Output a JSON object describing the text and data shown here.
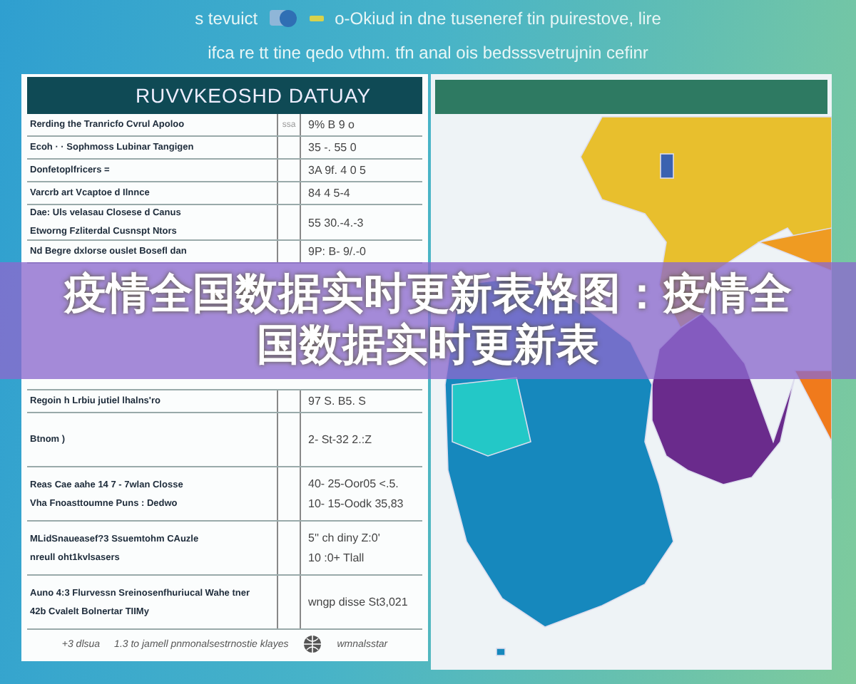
{
  "header": {
    "line_1": "s tevuict",
    "line_1_rest": "o-Okiud in dne tuseneref tin puirestove, lire",
    "line_2": "ifca re tt tine qedo vthm. tfn anal ois bedsssvetrujnin cefinr"
  },
  "table": {
    "title": "RUVVKEOSHD DATUAY",
    "rows": [
      {
        "text": [
          "Rerding the Tranricfo Cvrul Apoloo"
        ],
        "column_2": "ssa",
        "value": [
          "9% B 9 o"
        ]
      },
      {
        "text": [
          "Ecoh · · Sophmoss Lubinar Tangigen"
        ],
        "value": [
          "35 -. 55 0"
        ]
      },
      {
        "text": [
          "Donfetoplfricers ="
        ],
        "value": [
          "3A 9f. 4 0 5"
        ]
      },
      {
        "text": [
          "Varcrb art Vcaptoe d Ilnnce"
        ],
        "value": [
          "84 4 5-4"
        ]
      },
      {
        "text": [
          "Dae: Uls velasau Closese d Canus",
          "Etworng Fzliterdal Cusnspt Ntors"
        ],
        "value": [
          "55 30.-4.-3"
        ]
      },
      {
        "text": [
          "Nd Begre dxlorse ouslet Bosefl dan"
        ],
        "value": [
          "9P: B- 9/.-0"
        ]
      },
      {
        "text": [
          "Regoin h Lrbiu jutiel lhalns'ro"
        ],
        "value": [
          "97 S. B5. S"
        ]
      },
      {
        "text": [
          "Btnom )"
        ],
        "value": [
          "2- St-32 2.:Z"
        ]
      },
      {
        "text": [
          "Reas Cae aahe 14 7 - 7wlan Closse",
          "Vha Fnoasttoumne Puns : Dedwo"
        ],
        "value": [
          "40- 25-Oor05 <.5.",
          "10- 15-Oodk 35,83"
        ]
      },
      {
        "text": [
          "MLidSnaueasef?3 Ssuemtohm CAuzle",
          "nreull oht1kvlsasers"
        ],
        "value": [
          "5'' ch diny Z:0'",
          "10 :0+ Tlall"
        ]
      },
      {
        "text": [
          "Auno 4:3 Flurvessn Sreinosenfhuriucal Wahe tner",
          "42b Cvalelt Bolnertar TIIMy"
        ],
        "value": [
          "wngp disse St3,021"
        ]
      }
    ],
    "footer": [
      "+3 dlsua",
      "1.3 to jamell pnmonalsestrnostie klayes",
      "wmnalsstar"
    ]
  },
  "banner": {
    "title": "疫情全国数据实时更新表格图：疫情全国数据实时更新表"
  }
}
